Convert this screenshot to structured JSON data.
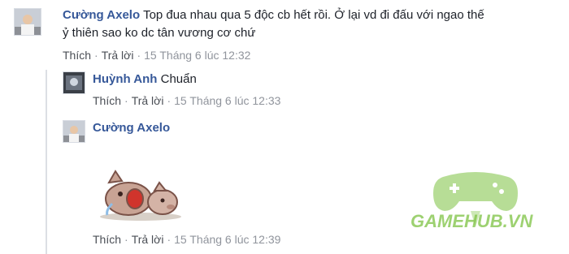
{
  "comments": [
    {
      "author": "Cường Axelo",
      "text_line1": "Top đua nhau qua 5 độc cb hết rồi. Ở lại vd đi đấu với ngao thế",
      "text_line2": "ỷ thiên sao ko dc tân vương cơ chứ",
      "like": "Thích",
      "reply": "Trả lời",
      "time": "15 Tháng 6 lúc 12:32"
    }
  ],
  "replies": [
    {
      "author": "Huỳnh Anh",
      "text": "Chuẩn",
      "like": "Thích",
      "reply": "Trả lời",
      "time": "15 Tháng 6 lúc 12:33"
    },
    {
      "author": "Cường Axelo",
      "text": "",
      "sticker": "crying-pig-sticker",
      "like": "Thích",
      "reply": "Trả lời",
      "time": "15 Tháng 6 lúc 12:39"
    }
  ],
  "watermark": {
    "text": "GAMEHUB.VN",
    "color": "#7dc242",
    "icon": "gamepad-icon"
  },
  "colors": {
    "author": "#365899",
    "meta": "#90949c",
    "text": "#1d2129"
  },
  "separator": "·"
}
